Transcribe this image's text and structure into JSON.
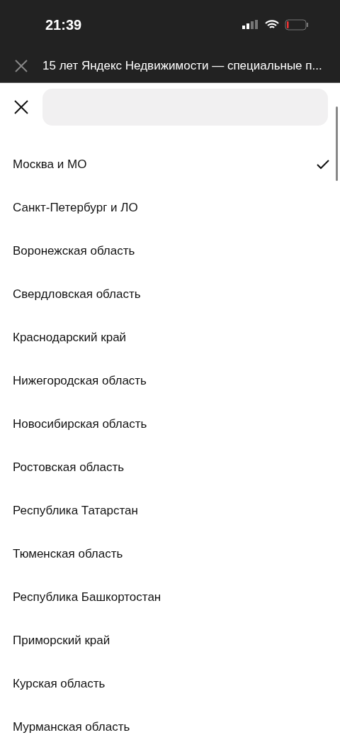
{
  "status_bar": {
    "time": "21:39"
  },
  "header": {
    "title": "15 лет Яндекс Недвижимости — специальные п..."
  },
  "regions": [
    {
      "name": "Москва и МО",
      "selected": true
    },
    {
      "name": "Санкт-Петербург и ЛО",
      "selected": false
    },
    {
      "name": "Воронежская область",
      "selected": false
    },
    {
      "name": "Свердловская область",
      "selected": false
    },
    {
      "name": "Краснодарский край",
      "selected": false
    },
    {
      "name": "Нижегородская область",
      "selected": false
    },
    {
      "name": "Новосибирская область",
      "selected": false
    },
    {
      "name": "Ростовская область",
      "selected": false
    },
    {
      "name": "Республика Татарстан",
      "selected": false
    },
    {
      "name": "Тюменская область",
      "selected": false
    },
    {
      "name": "Республика Башкортостан",
      "selected": false
    },
    {
      "name": "Приморский край",
      "selected": false
    },
    {
      "name": "Курская область",
      "selected": false
    },
    {
      "name": "Мурманская область",
      "selected": false
    }
  ]
}
